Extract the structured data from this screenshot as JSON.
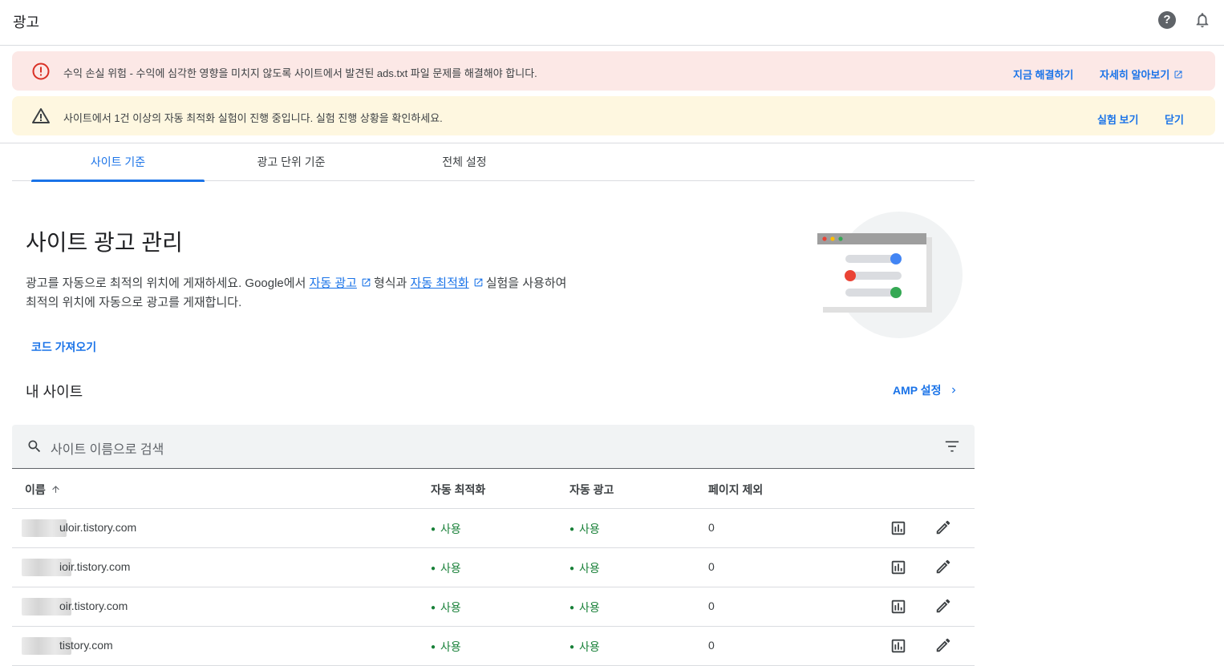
{
  "app": {
    "title": "광고"
  },
  "colors": {
    "accent": "#1a73e8",
    "success": "#188038",
    "error_bg": "#fce8e6",
    "warn_bg": "#fef7e0",
    "error_icon": "#d93025"
  },
  "banners": {
    "error": {
      "icon": "error-icon",
      "message": "수익 손실 위험 - 수익에 심각한 영향을 미치지 않도록 사이트에서 발견된 ads.txt 파일 문제를 해결해야 합니다.",
      "action_fix": "지금 해결하기",
      "action_learn": "자세히 알아보기"
    },
    "warn": {
      "icon": "warning-icon",
      "message": "사이트에서 1건 이상의 자동 최적화 실험이 진행 중입니다. 실험 진행 상황을 확인하세요.",
      "action_view": "실험 보기",
      "action_close": "닫기"
    }
  },
  "tabs": [
    {
      "label": "사이트 기준",
      "active": true
    },
    {
      "label": "광고 단위 기준",
      "active": false
    },
    {
      "label": "전체 설정",
      "active": false
    }
  ],
  "header": {
    "title": "사이트 광고 관리",
    "desc_part1": "광고를 자동으로 최적의 위치에 게재하세요. Google에서",
    "desc_link1": "자동 광고",
    "desc_part2": "형식과",
    "desc_link2": "자동 최적화",
    "desc_part3": "실험을 사용하여",
    "desc_line2": "최적의 위치에 자동으로 광고를 게재합니다.",
    "get_code": "코드 가져오기"
  },
  "sites_section": {
    "title": "내 사이트",
    "amp_link": "AMP 설정",
    "search_placeholder": "사이트 이름으로 검색"
  },
  "table": {
    "columns": {
      "name": "이름",
      "auto_opt": "자동 최적화",
      "auto_ads": "자동 광고",
      "excluded": "페이지 제외"
    },
    "rows": [
      {
        "name": "uloir.tistory.com",
        "auto_opt": "사용",
        "auto_ads": "사용",
        "excluded": "0"
      },
      {
        "name": "ioir.tistory.com",
        "auto_opt": "사용",
        "auto_ads": "사용",
        "excluded": "0"
      },
      {
        "name": "oir.tistory.com",
        "auto_opt": "사용",
        "auto_ads": "사용",
        "excluded": "0"
      },
      {
        "name": "tistory.com",
        "auto_opt": "사용",
        "auto_ads": "사용",
        "excluded": "0"
      }
    ]
  }
}
